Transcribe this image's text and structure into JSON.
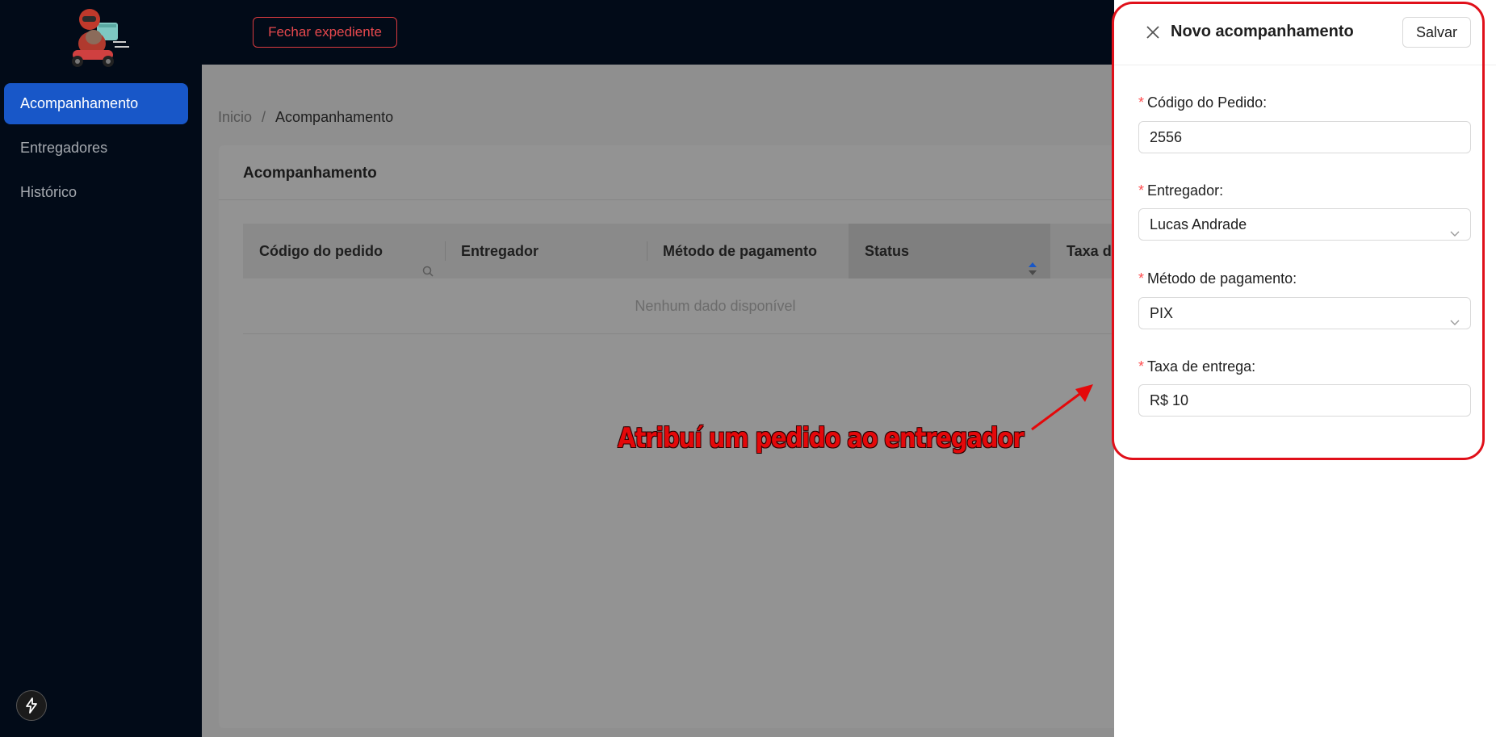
{
  "sidebar": {
    "items": [
      {
        "label": "Acompanhamento",
        "active": true
      },
      {
        "label": "Entregadores",
        "active": false
      },
      {
        "label": "Histórico",
        "active": false
      }
    ],
    "bottom_icon": "lightning-icon"
  },
  "header": {
    "close_shift_label": "Fechar expediente"
  },
  "breadcrumb": {
    "home": "Inicio",
    "separator": "/",
    "current": "Acompanhamento"
  },
  "card": {
    "title": "Acompanhamento",
    "columns": [
      "Código do pedido",
      "Entregador",
      "Método de pagamento",
      "Status",
      "Taxa de"
    ],
    "empty_text": "Nenhum dado disponível"
  },
  "annotation": {
    "text": "Atribuí um pedido ao entregador",
    "color": "#e4080a"
  },
  "drawer": {
    "title": "Novo acompanhamento",
    "save_label": "Salvar",
    "fields": [
      {
        "label": "Código do Pedido:",
        "value": "2556",
        "type": "text"
      },
      {
        "label": "Entregador:",
        "value": "Lucas Andrade",
        "type": "select"
      },
      {
        "label": "Método de pagamento:",
        "value": "PIX",
        "type": "select"
      },
      {
        "label": "Taxa de entrega:",
        "value": "R$ 10",
        "type": "text"
      }
    ],
    "required_mark": "*"
  },
  "colors": {
    "sidebar_bg": "#020b18",
    "active_item": "#1857c8",
    "danger": "#e5484d"
  }
}
